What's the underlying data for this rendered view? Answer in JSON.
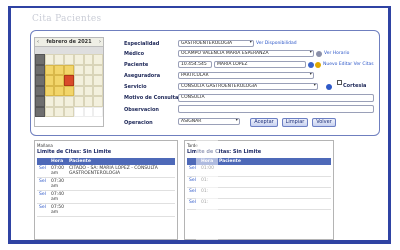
{
  "page_title": "Cita Pacientes",
  "calendar": {
    "month_label": "febrero de 2021",
    "prev": "‹",
    "next": "›",
    "dow": [
      "",
      "",
      "",
      "",
      "",
      "",
      ""
    ],
    "days": [
      "",
      "",
      "",
      "",
      "",
      "",
      "",
      "",
      "",
      "",
      "",
      "",
      "",
      "",
      "",
      "",
      "",
      "",
      "",
      "",
      "",
      "",
      "",
      "",
      "",
      "",
      "",
      "",
      "",
      "",
      "",
      "",
      "",
      "",
      "",
      "",
      "",
      "",
      "",
      "",
      "",
      "",
      "",
      "",
      "",
      "",
      "",
      "",
      "",
      "",
      "",
      "",
      "",
      "",
      "",
      ""
    ]
  },
  "form": {
    "especialidad": {
      "label": "Especialidad",
      "value": "GASTROENTEROLOGIA",
      "link": "Ver Disponibilidad"
    },
    "medico": {
      "label": "Médico",
      "value": "OCAMPO VALENCIA MARIA ESPERANZA",
      "link": "Ver Horario"
    },
    "paciente": {
      "label": "Paciente",
      "id_value": "10.454.545",
      "name_value": "MARIA LOPEZ",
      "link": "Nuevo Editar Ver Citas"
    },
    "aseguradora": {
      "label": "Aseguradora",
      "value": "PARTICULAR"
    },
    "servicio": {
      "label": "Servicio",
      "value": "CONSULTA GASTROENTEROLOGIA",
      "cortesia_label": "Cortesia"
    },
    "motivo": {
      "label": "Motivo de Consulta",
      "value": "CONSULTA"
    },
    "observacion": {
      "label": "Observacion",
      "value": ""
    },
    "operacion": {
      "label": "Operacion",
      "value": "ASIGNAR"
    }
  },
  "buttons": {
    "aceptar": "Aceptar",
    "limpiar": "Limpiar",
    "volver": "Volver"
  },
  "manana": {
    "caption": "Mañana",
    "limit": "Limite de Citas: Sin Limite",
    "columns": [
      "",
      "Hora",
      "Paciente"
    ],
    "rows": [
      {
        "sel": "Sel",
        "hora": "07:00 am",
        "paciente": "CITADO - SA: MARIA LOPEZ - CONSULTA GASTROENTEROLOGIA"
      },
      {
        "sel": "Sel",
        "hora": "07:30 am",
        "paciente": ""
      },
      {
        "sel": "Sel",
        "hora": "07:40 am",
        "paciente": ""
      },
      {
        "sel": "Sel",
        "hora": "07:50 am",
        "paciente": ""
      }
    ]
  },
  "tarde": {
    "caption": "Tarde",
    "limit": "Limite de Citas: Sin Limite",
    "columns": [
      "",
      "Hora",
      "Paciente"
    ],
    "rows": [
      {
        "sel": "Sel",
        "hora": "01:00",
        "paciente": ""
      },
      {
        "sel": "Sel",
        "hora": "01:",
        "paciente": ""
      },
      {
        "sel": "Sel",
        "hora": "01:",
        "paciente": ""
      },
      {
        "sel": "Sel",
        "hora": "01:",
        "paciente": ""
      }
    ]
  },
  "colors": {
    "frame": "#2f43a3",
    "header": "#4e69b8",
    "label": "#202a5a",
    "link": "#2a55c8"
  }
}
